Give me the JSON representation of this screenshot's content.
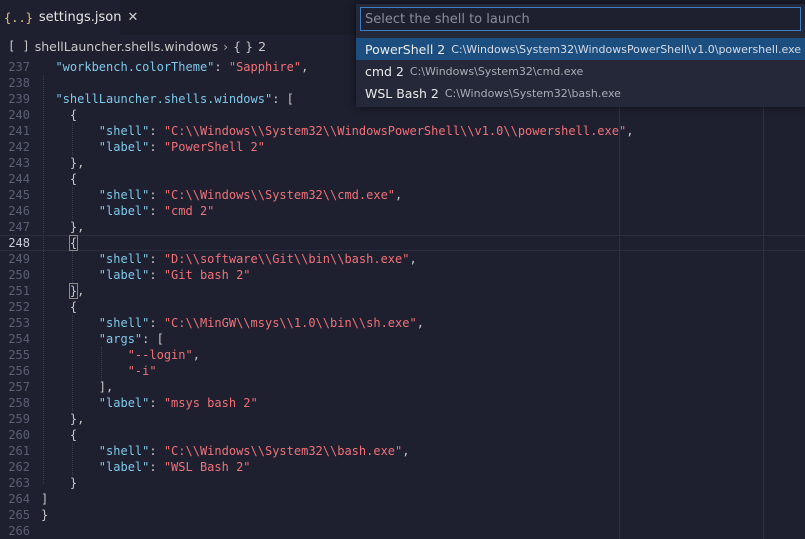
{
  "tab": {
    "icon": "{..}",
    "title": "settings.json",
    "close": "✕"
  },
  "breadcrumb": {
    "icon": "[ ]",
    "path": "shellLauncher.shells.windows",
    "sep": "›",
    "obj_icon": "{ }",
    "index": "2"
  },
  "palette": {
    "placeholder": "Select the shell to launch",
    "items": [
      {
        "label": "PowerShell 2",
        "path": "C:\\Windows\\System32\\WindowsPowerShell\\v1.0\\powershell.exe"
      },
      {
        "label": "cmd 2",
        "path": "C:\\Windows\\System32\\cmd.exe"
      },
      {
        "label": "WSL Bash 2",
        "path": "C:\\Windows\\System32\\bash.exe"
      }
    ]
  },
  "editor": {
    "current_line": 248,
    "lines": [
      {
        "n": "237",
        "segs": [
          [
            "p",
            "  "
          ],
          [
            "k",
            "\"workbench.colorTheme\""
          ],
          [
            "p",
            ": "
          ],
          [
            "s",
            "\"Sapphire\""
          ],
          [
            "p",
            ","
          ]
        ]
      },
      {
        "n": "238",
        "segs": []
      },
      {
        "n": "239",
        "segs": [
          [
            "p",
            "  "
          ],
          [
            "k",
            "\"shellLauncher.shells.windows\""
          ],
          [
            "p",
            ": ["
          ]
        ]
      },
      {
        "n": "240",
        "segs": [
          [
            "p",
            "    {"
          ]
        ]
      },
      {
        "n": "241",
        "segs": [
          [
            "p",
            "        "
          ],
          [
            "k",
            "\"shell\""
          ],
          [
            "p",
            ": "
          ],
          [
            "s",
            "\"C:\\\\Windows\\\\System32\\\\WindowsPowerShell\\\\v1.0\\\\powershell.exe\""
          ],
          [
            "p",
            ","
          ]
        ]
      },
      {
        "n": "242",
        "segs": [
          [
            "p",
            "        "
          ],
          [
            "k",
            "\"label\""
          ],
          [
            "p",
            ": "
          ],
          [
            "s",
            "\"PowerShell 2\""
          ]
        ]
      },
      {
        "n": "243",
        "segs": [
          [
            "p",
            "    },"
          ]
        ]
      },
      {
        "n": "244",
        "segs": [
          [
            "p",
            "    {"
          ]
        ]
      },
      {
        "n": "245",
        "segs": [
          [
            "p",
            "        "
          ],
          [
            "k",
            "\"shell\""
          ],
          [
            "p",
            ": "
          ],
          [
            "s",
            "\"C:\\\\Windows\\\\System32\\\\cmd.exe\""
          ],
          [
            "p",
            ","
          ]
        ]
      },
      {
        "n": "246",
        "segs": [
          [
            "p",
            "        "
          ],
          [
            "k",
            "\"label\""
          ],
          [
            "p",
            ": "
          ],
          [
            "s",
            "\"cmd 2\""
          ]
        ]
      },
      {
        "n": "247",
        "segs": [
          [
            "p",
            "    },"
          ]
        ]
      },
      {
        "n": "248",
        "segs": [
          [
            "p",
            "    "
          ],
          [
            "b",
            "{"
          ]
        ]
      },
      {
        "n": "249",
        "segs": [
          [
            "p",
            "        "
          ],
          [
            "k",
            "\"shell\""
          ],
          [
            "p",
            ": "
          ],
          [
            "s",
            "\"D:\\\\software\\\\Git\\\\bin\\\\bash.exe\""
          ],
          [
            "p",
            ","
          ]
        ]
      },
      {
        "n": "250",
        "segs": [
          [
            "p",
            "        "
          ],
          [
            "k",
            "\"label\""
          ],
          [
            "p",
            ": "
          ],
          [
            "s",
            "\"Git bash 2\""
          ]
        ]
      },
      {
        "n": "251",
        "segs": [
          [
            "p",
            "    "
          ],
          [
            "b",
            "}"
          ],
          [
            "p",
            ","
          ]
        ]
      },
      {
        "n": "252",
        "segs": [
          [
            "p",
            "    {"
          ]
        ]
      },
      {
        "n": "253",
        "segs": [
          [
            "p",
            "        "
          ],
          [
            "k",
            "\"shell\""
          ],
          [
            "p",
            ": "
          ],
          [
            "s",
            "\"C:\\\\MinGW\\\\msys\\\\1.0\\\\bin\\\\sh.exe\""
          ],
          [
            "p",
            ","
          ]
        ]
      },
      {
        "n": "254",
        "segs": [
          [
            "p",
            "        "
          ],
          [
            "k",
            "\"args\""
          ],
          [
            "p",
            ": ["
          ]
        ]
      },
      {
        "n": "255",
        "segs": [
          [
            "p",
            "            "
          ],
          [
            "s",
            "\"--login\""
          ],
          [
            "p",
            ","
          ]
        ]
      },
      {
        "n": "256",
        "segs": [
          [
            "p",
            "            "
          ],
          [
            "s",
            "\"-i\""
          ]
        ]
      },
      {
        "n": "257",
        "segs": [
          [
            "p",
            "        ],"
          ]
        ]
      },
      {
        "n": "258",
        "segs": [
          [
            "p",
            "        "
          ],
          [
            "k",
            "\"label\""
          ],
          [
            "p",
            ": "
          ],
          [
            "s",
            "\"msys bash 2\""
          ]
        ]
      },
      {
        "n": "259",
        "segs": [
          [
            "p",
            "    },"
          ]
        ]
      },
      {
        "n": "260",
        "segs": [
          [
            "p",
            "    {"
          ]
        ]
      },
      {
        "n": "261",
        "segs": [
          [
            "p",
            "        "
          ],
          [
            "k",
            "\"shell\""
          ],
          [
            "p",
            ": "
          ],
          [
            "s",
            "\"C:\\\\Windows\\\\System32\\\\bash.exe\""
          ],
          [
            "p",
            ","
          ]
        ]
      },
      {
        "n": "262",
        "segs": [
          [
            "p",
            "        "
          ],
          [
            "k",
            "\"label\""
          ],
          [
            "p",
            ": "
          ],
          [
            "s",
            "\"WSL Bash 2\""
          ]
        ]
      },
      {
        "n": "263",
        "segs": [
          [
            "p",
            "    }"
          ]
        ]
      },
      {
        "n": "264",
        "segs": [
          [
            "p",
            "]"
          ]
        ]
      },
      {
        "n": "265",
        "segs": [
          [
            "p",
            "}"
          ]
        ]
      },
      {
        "n": "266",
        "segs": []
      }
    ]
  }
}
